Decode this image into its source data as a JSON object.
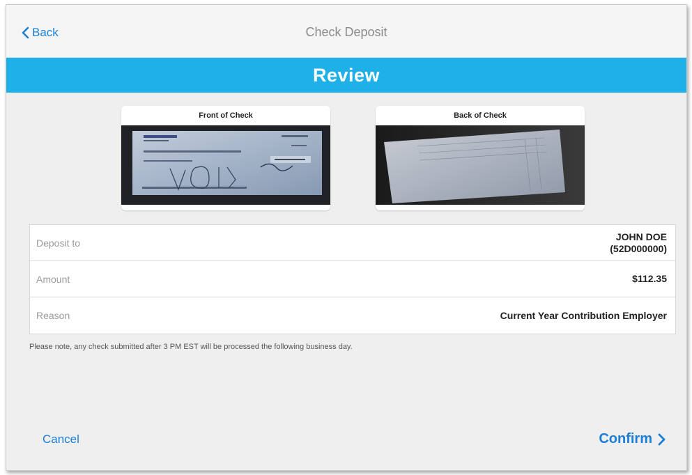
{
  "nav": {
    "back_label": "Back",
    "title": "Check Deposit"
  },
  "banner": {
    "title": "Review"
  },
  "checks": {
    "front_label": "Front of Check",
    "back_label": "Back of Check"
  },
  "details": {
    "rows": [
      {
        "label": "Deposit to",
        "value_line1": "JOHN DOE",
        "value_line2": "(52D000000)"
      },
      {
        "label": "Amount",
        "value_line1": "$112.35"
      },
      {
        "label": "Reason",
        "value_line1": "Current Year Contribution Employer"
      }
    ]
  },
  "note": "Please note, any check submitted after 3 PM EST will be processed the following business day.",
  "actions": {
    "cancel_label": "Cancel",
    "confirm_label": "Confirm"
  },
  "colors": {
    "accent_blue": "#1a7fd6",
    "banner_blue": "#1eb0e8",
    "background": "#efefef"
  },
  "icons": {
    "back": "chevron-left-icon",
    "confirm": "chevron-right-icon"
  }
}
